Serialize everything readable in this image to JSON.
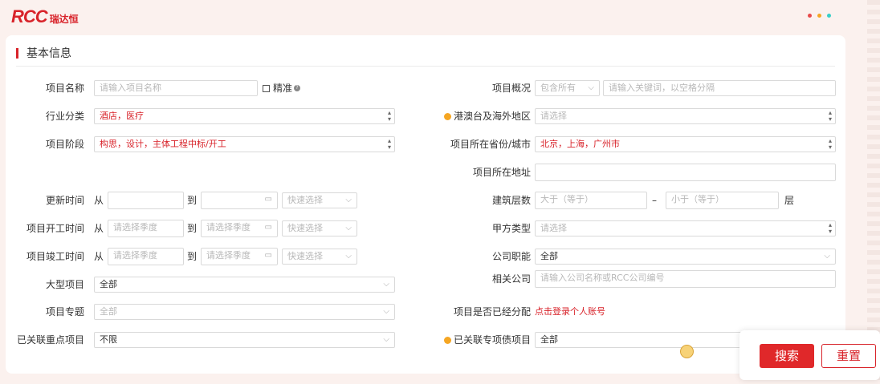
{
  "brand": {
    "logo": "RCC",
    "logo_sub": "瑞达恒"
  },
  "colors": {
    "brand_red": "#d8232a",
    "dot1": "#e84a4a",
    "dot2": "#f5a623",
    "dot3": "#36cfc9"
  },
  "section": {
    "title": "基本信息"
  },
  "left": {
    "project_name": {
      "label": "项目名称",
      "placeholder": "请输入项目名称",
      "exact_label": "精准"
    },
    "industry": {
      "label": "行业分类",
      "value": "酒店，医疗"
    },
    "stage": {
      "label": "项目阶段",
      "value": "构思，设计，主体工程中标/开工"
    },
    "update_time": {
      "label": "更新时间",
      "from": "从",
      "to": "到",
      "quick": "快速选择"
    },
    "start_time": {
      "label": "项目开工时间",
      "from": "从",
      "to": "到",
      "placeholder": "请选择季度",
      "quick": "快速选择"
    },
    "end_time": {
      "label": "项目竣工时间",
      "from": "从",
      "to": "到",
      "placeholder": "请选择季度",
      "quick": "快速选择"
    },
    "large_project": {
      "label": "大型项目",
      "value": "全部"
    },
    "topic": {
      "label": "项目专题",
      "value": "全部"
    },
    "key_project": {
      "label": "已关联重点项目",
      "value": "不限"
    }
  },
  "right": {
    "overview": {
      "label": "项目概况",
      "select": "包含所有",
      "placeholder": "请输入关键词，以空格分隔"
    },
    "hk_region": {
      "label": "港澳台及海外地区",
      "placeholder": "请选择"
    },
    "province": {
      "label": "项目所在省份/城市",
      "value": "北京，上海，广州市"
    },
    "address": {
      "label": "项目所在地址",
      "value": ""
    },
    "floors": {
      "label": "建筑层数",
      "min_placeholder": "大于（等于）",
      "dash": "–",
      "max_placeholder": "小于（等于）",
      "unit": "层"
    },
    "owner_type": {
      "label": "甲方类型",
      "placeholder": "请选择"
    },
    "company_role": {
      "label": "公司职能",
      "value": "全部"
    },
    "company": {
      "label": "相关公司",
      "placeholder": "请输入公司名称或RCC公司编号"
    },
    "assigned": {
      "label": "项目是否已经分配",
      "link": "点击登录个人账号"
    },
    "debt_project": {
      "label": "已关联专项债项目",
      "value": "全部"
    }
  },
  "buttons": {
    "search": "搜索",
    "reset": "重置"
  }
}
